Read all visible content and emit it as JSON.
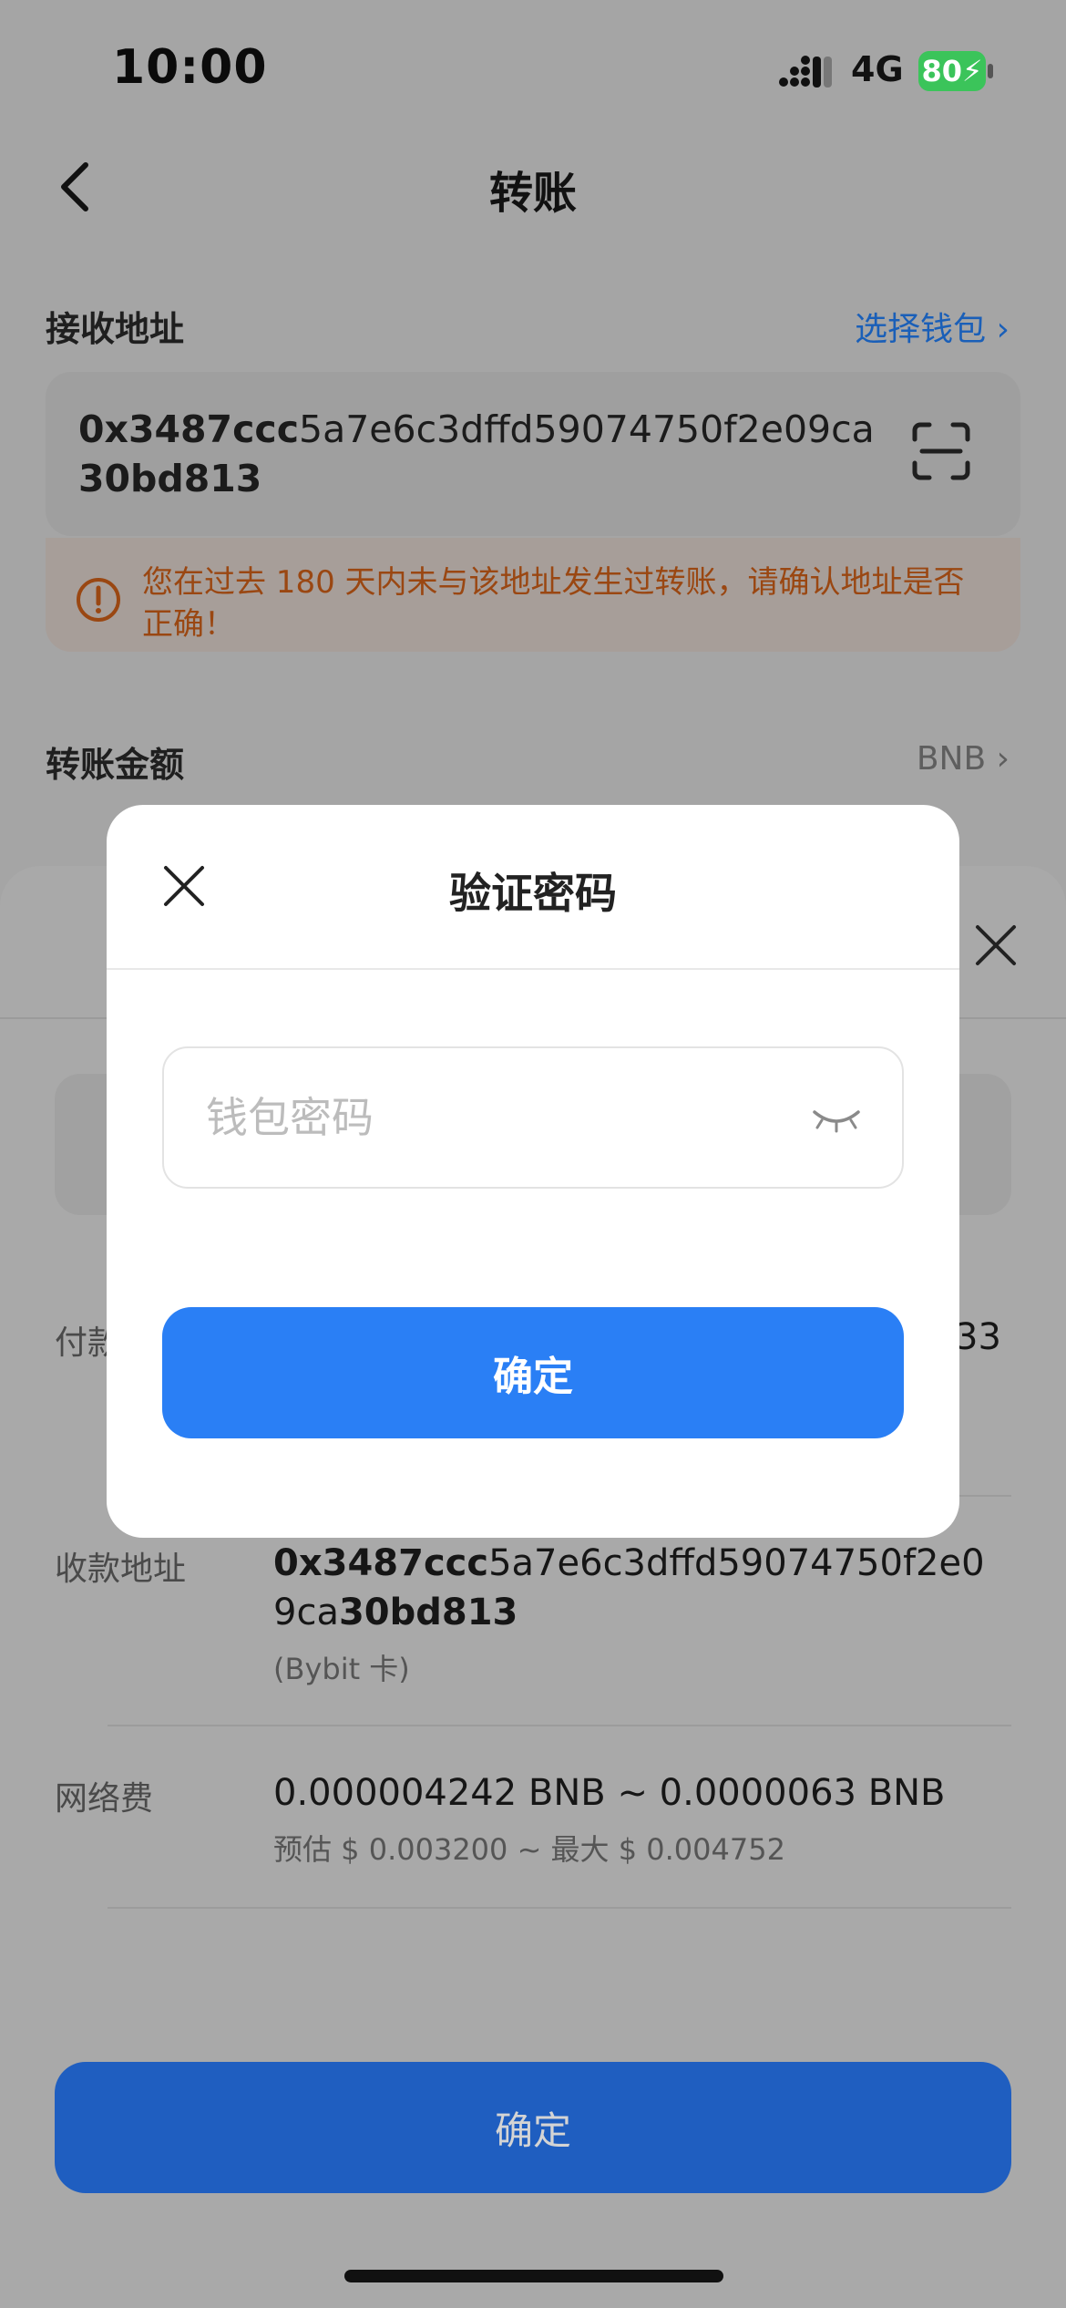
{
  "status_bar": {
    "time": "10:00",
    "network": "4G",
    "battery": "80"
  },
  "nav": {
    "title": "转账"
  },
  "receive": {
    "label": "接收地址",
    "choose_wallet": "选择钱包 ›",
    "address_prefix": "0x3487ccc",
    "address_middle": "5a7e6c3dffd59074750f2e09ca",
    "address_suffix": "30bd813",
    "warning": "您在过去 180 天内未与该地址发生过转账，请确认地址是否正确！"
  },
  "amount": {
    "label": "转账金额",
    "token": "BNB ›"
  },
  "sheet": {
    "pay_label": "付款",
    "pay_value_tail": "33",
    "recv_label": "收款地址",
    "recv_prefix": "0x3487ccc",
    "recv_middle": "5a7e6c3dffd59074750f2e09ca",
    "recv_suffix": "30bd813",
    "recv_note": "(Bybit 卡)",
    "fee_label": "网络费",
    "fee_value": "0.000004242 BNB ~ 0.0000063 BNB",
    "fee_sub": "预估 $ 0.003200 ~ 最大 $ 0.004752",
    "confirm": "确定"
  },
  "modal": {
    "title": "验证密码",
    "password_placeholder": "钱包密码",
    "password_value": "",
    "confirm": "确定"
  },
  "colors": {
    "accent": "#2a7ff5",
    "warning": "#9a4712",
    "battery": "#3bc45a"
  },
  "icons": [
    "back-icon",
    "scan-icon",
    "warning-icon",
    "close-icon",
    "eye-closed-icon",
    "signal-icon"
  ]
}
